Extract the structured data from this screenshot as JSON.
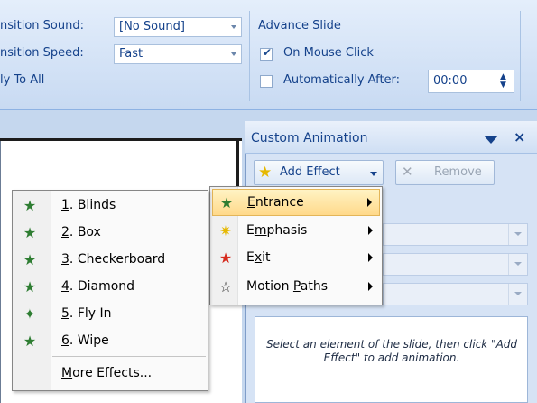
{
  "ribbon": {
    "transition_sound_label": "nsition Sound:",
    "transition_sound_value": "[No Sound]",
    "transition_speed_label": "nsition Speed:",
    "transition_speed_value": "Fast",
    "apply_to_all": "ly To All",
    "advance_slide_title": "Advance Slide",
    "on_mouse_click": "On Mouse Click",
    "automatically_after": "Automatically After:",
    "time_value": "00:00"
  },
  "pane": {
    "title": "Custom Animation",
    "add_effect": "Add Effect",
    "remove": "Remove",
    "hint": "Select an element of the slide, then click \"Add Effect\" to add animation."
  },
  "effect_menu": [
    {
      "key": "E",
      "rest": "ntrance",
      "icon": "green-star-icon"
    },
    {
      "key": "m",
      "pre": "E",
      "rest": "phasis",
      "icon": "yellow-star-icon"
    },
    {
      "key": "x",
      "pre": "E",
      "rest": "it",
      "icon": "red-star-icon"
    },
    {
      "pre": "Motion ",
      "key": "P",
      "rest": "aths",
      "icon": "outline-star-icon"
    }
  ],
  "entrance_menu": [
    {
      "key": "1",
      "rest": ". Blinds"
    },
    {
      "key": "2",
      "rest": ". Box"
    },
    {
      "key": "3",
      "rest": ". Checkerboard"
    },
    {
      "key": "4",
      "rest": ". Diamond"
    },
    {
      "key": "5",
      "rest": ". Fly In"
    },
    {
      "key": "6",
      "rest": ". Wipe"
    },
    {
      "key": "M",
      "rest": "ore Effects..."
    }
  ]
}
